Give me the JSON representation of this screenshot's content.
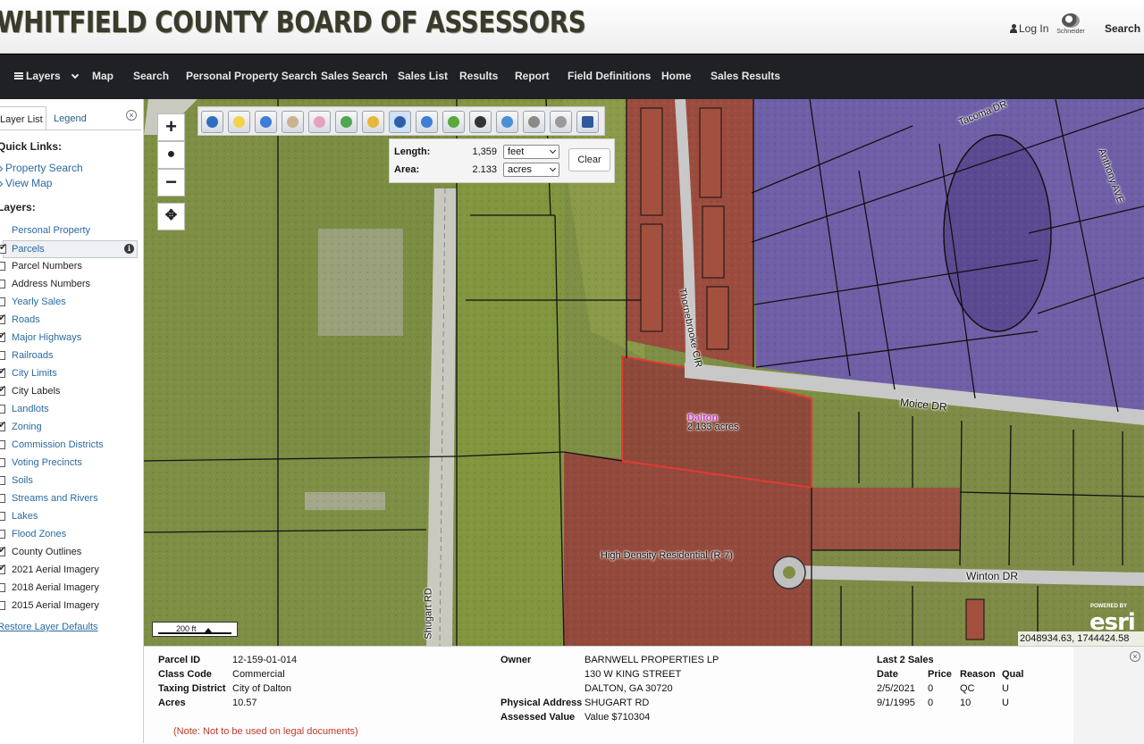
{
  "header": {
    "title": "WHITFIELD COUNTY BOARD OF ASSESSORS",
    "login_label": "Log In",
    "logo_text": "Schneider",
    "search_label": "Search"
  },
  "navbar": {
    "items": [
      "Layers",
      "Map",
      "Search",
      "Personal Property Search",
      "Sales Search",
      "Sales List",
      "Results",
      "Report",
      "Field Definitions",
      "Home",
      "Sales Results"
    ]
  },
  "side_panel": {
    "tabs": [
      "Layer List",
      "Legend"
    ],
    "quick_links_heading": "Quick Links:",
    "quick_links": [
      "Property Search",
      "View Map"
    ],
    "layers_heading": "Layers:",
    "layers": [
      {
        "label": "Personal Property",
        "checked": false
      },
      {
        "label": "Parcels",
        "checked": true
      },
      {
        "label": "Parcel Numbers",
        "checked": false
      },
      {
        "label": "Address Numbers",
        "checked": false
      },
      {
        "label": "Yearly Sales",
        "checked": false
      },
      {
        "label": "Roads",
        "checked": true
      },
      {
        "label": "Major Highways",
        "checked": true
      },
      {
        "label": "Railroads",
        "checked": false
      },
      {
        "label": "City Limits",
        "checked": true
      },
      {
        "label": "City Labels",
        "checked": true
      },
      {
        "label": "Landlots",
        "checked": false
      },
      {
        "label": "Zoning",
        "checked": true
      },
      {
        "label": "Commission Districts",
        "checked": false
      },
      {
        "label": "Voting Precincts",
        "checked": false
      },
      {
        "label": "Soils",
        "checked": false
      },
      {
        "label": "Streams and Rivers",
        "checked": false
      },
      {
        "label": "Lakes",
        "checked": false
      },
      {
        "label": "Flood Zones",
        "checked": false
      },
      {
        "label": "County Outlines",
        "checked": true
      },
      {
        "label": "2021 Aerial Imagery",
        "checked": true
      },
      {
        "label": "2018 Aerial Imagery",
        "checked": false
      },
      {
        "label": "2015 Aerial Imagery",
        "checked": false
      }
    ],
    "restore_label": "Restore Layer Defaults"
  },
  "map": {
    "measure": {
      "length_label": "Length:",
      "length_value": "1,359",
      "length_unit": "feet",
      "area_label": "Area:",
      "area_value": "2.133",
      "area_unit": "acres",
      "clear_label": "Clear"
    },
    "labels": {
      "dalton": "Dalton",
      "acres": "2.133 acres",
      "zoning": "High Density Residential (R-7)",
      "moice": "Moice DR",
      "winton": "Winton DR",
      "shugart": "Shugart RD",
      "thornebrooke": "Thornebrooke CIR",
      "tacoma": "Tacoma DR",
      "anthony": "Anthony AVE"
    },
    "scale": "200 ft",
    "esri_powered": "POWERED BY",
    "esri": "esri",
    "coords": "2048934.63, 1744424.58",
    "tools": [
      "info-icon",
      "highlight-icon",
      "zoom-in-icon",
      "pan-icon",
      "eraser-icon",
      "select-icon",
      "marker-icon",
      "measure-icon",
      "zoom-out-icon",
      "draw-icon",
      "buffer-icon",
      "identify-icon",
      "settings-icon",
      "print-icon",
      "save-icon"
    ]
  },
  "info": {
    "parcel_id_label": "Parcel ID",
    "parcel_id": "12-159-01-014",
    "class_code_label": "Class Code",
    "class_code": "Commercial",
    "taxing_district_label": "Taxing District",
    "taxing_district": "City of Dalton",
    "acres_label": "Acres",
    "acres": "10.57",
    "owner_label": "Owner",
    "owner_line1": "BARNWELL PROPERTIES LP",
    "owner_line2": "130 W KING STREET",
    "owner_line3": "DALTON, GA 30720",
    "physical_address_label": "Physical Address",
    "physical_address": "SHUGART RD",
    "assessed_value_label": "Assessed Value",
    "assessed_value": "Value $710304",
    "sales_heading": "Last 2 Sales",
    "sales_columns": [
      "Date",
      "Price",
      "Reason",
      "Qual"
    ],
    "sales": [
      [
        "2/5/2021",
        "0",
        "QC",
        "U"
      ],
      [
        "9/1/1995",
        "0",
        "10",
        "U"
      ]
    ],
    "note": "(Note: Not to be used on legal documents)"
  }
}
